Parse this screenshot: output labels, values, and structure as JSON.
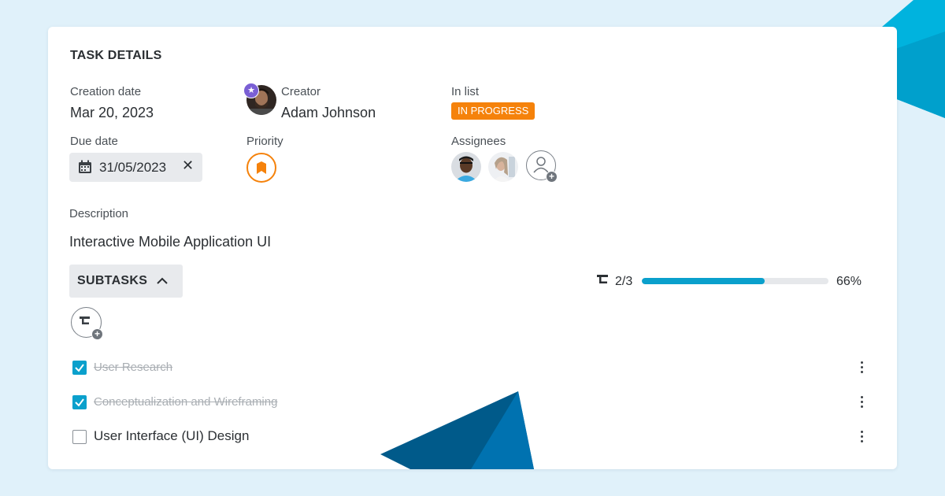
{
  "card": {
    "title": "TASK DETAILS"
  },
  "fields": {
    "creation_date": {
      "label": "Creation date",
      "value": "Mar 20, 2023"
    },
    "creator": {
      "label": "Creator",
      "name": "Adam Johnson"
    },
    "in_list": {
      "label": "In list",
      "status": "IN PROGRESS"
    },
    "due_date": {
      "label": "Due date",
      "value": "31/05/2023"
    },
    "priority": {
      "label": "Priority"
    },
    "assignees": {
      "label": "Assignees"
    }
  },
  "description": {
    "label": "Description",
    "text": "Interactive Mobile Application UI"
  },
  "subtasks": {
    "header": "SUBTASKS",
    "progress_count": "2/3",
    "progress_percent_label": "66%",
    "progress_fraction": 0.66,
    "items": [
      {
        "label": "User Research",
        "done": true
      },
      {
        "label": "Conceptualization and Wireframing",
        "done": true
      },
      {
        "label": "User Interface (UI) Design",
        "done": false
      }
    ]
  },
  "colors": {
    "accent": "#0aa0cc",
    "status_orange": "#f5820b",
    "badge_purple": "#7a5fd4",
    "background": "#e0f1fa"
  },
  "icons": [
    "calendar-icon",
    "close-icon",
    "priority-flag-icon",
    "add-assignee-icon",
    "chevron-up-icon",
    "subtask-icon",
    "add-subtask-icon",
    "checkbox-icon",
    "more-vertical-icon",
    "star-badge-icon"
  ]
}
